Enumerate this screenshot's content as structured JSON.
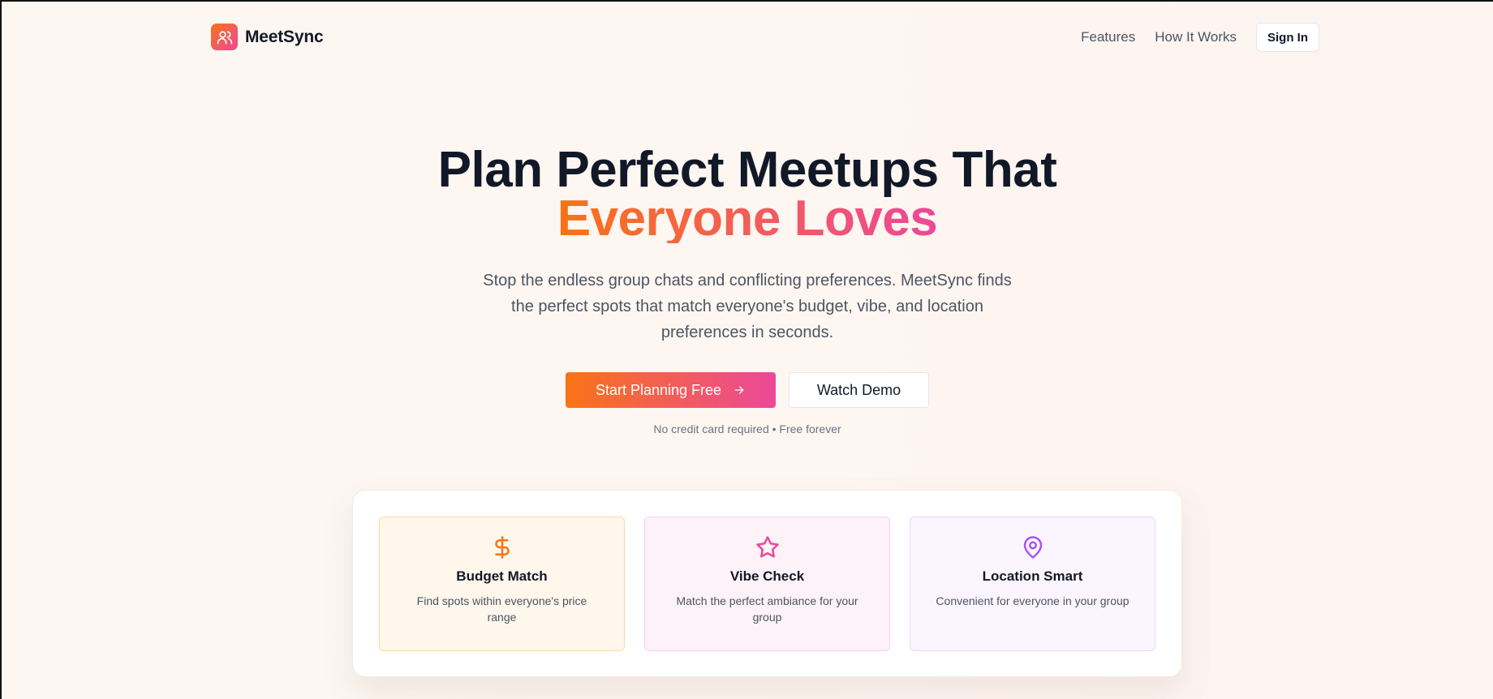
{
  "header": {
    "brand_name": "MeetSync",
    "nav": {
      "features": "Features",
      "how_it_works": "How It Works",
      "sign_in": "Sign In"
    }
  },
  "hero": {
    "title_line1": "Plan Perfect Meetups That",
    "title_line2": "Everyone Loves",
    "subtitle": "Stop the endless group chats and conflicting preferences. MeetSync finds the perfect spots that match everyone's budget, vibe, and location preferences in seconds.",
    "primary_cta": "Start Planning Free",
    "secondary_cta": "Watch Demo",
    "note": "No credit card required • Free forever"
  },
  "features": [
    {
      "title": "Budget Match",
      "description": "Find spots within everyone's price range",
      "icon": "dollar-icon"
    },
    {
      "title": "Vibe Check",
      "description": "Match the perfect ambiance for your group",
      "icon": "star-icon"
    },
    {
      "title": "Location Smart",
      "description": "Convenient for everyone in your group",
      "icon": "map-pin-icon"
    }
  ],
  "colors": {
    "accent_orange": "#f97316",
    "accent_pink": "#ec4899",
    "accent_purple": "#a855f7",
    "text_dark": "#111827",
    "text_muted": "#4b5563"
  }
}
